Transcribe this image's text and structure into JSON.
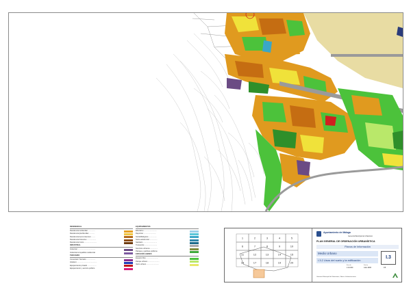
{
  "map": {
    "description_colors": {
      "residential_yellow": "#f0e23a",
      "residential_orange": "#e09a1f",
      "residential_darkorange": "#c56d12",
      "green_space": "#4cc23b",
      "dark_green": "#2f8f2a",
      "industrial_tan": "#e8dca3",
      "equipment_purple": "#6b4b84",
      "road_gray": "#9a9a9a",
      "water_blue": "#3aa7c8",
      "red": "#d0201f",
      "light_green": "#b9e86a"
    }
  },
  "legend": {
    "left_col": {
      "heading_a": "RESIDENCIAL",
      "items_a": [
        {
          "label": "Residencial unifamiliar ..............",
          "color": "#e6a125"
        },
        {
          "label": "Residencial plurifamiliar ...........",
          "color": "#f0c540"
        },
        {
          "label": "Residencial semi-intensivo ........",
          "color": "#b56a1a"
        },
        {
          "label": "Residencial intensivo ..................",
          "color": "#8c4c12"
        },
        {
          "label": "Residencial mixto .........................",
          "color": "#6e3a0e"
        }
      ],
      "heading_b": "INDUSTRIAL",
      "items_b": [
        {
          "label": "Industrial ....................................",
          "color": "#6b4b84"
        },
        {
          "label": "Industrial compatible residencial",
          "color": "#7c5aa0"
        }
      ],
      "heading_c": "TERCIARIO",
      "items_c": [
        {
          "label": "Comercial / Terciario ..................",
          "color": "#8a2b8e"
        },
        {
          "label": "Hotelero ........................................",
          "color": "#1e3ab5"
        },
        {
          "label": "Equipamiento privado ..................",
          "color": "#c01818"
        },
        {
          "label": "Equipamiento y servicio público",
          "color": "#d7197a"
        }
      ]
    },
    "right_col": {
      "heading_a": "EQUIPAMIENTOS",
      "items_a": [
        {
          "label": "Educativo ..........................",
          "color": "#9dd0e8"
        },
        {
          "label": "Deportivo .........................",
          "color": "#58c6d8"
        },
        {
          "label": "Social/Religioso ................",
          "color": "#3aa7c8"
        },
        {
          "label": "Socio-asistencial ................",
          "color": "#2f86a8"
        },
        {
          "label": "Sanitario ............................",
          "color": "#1b6a8a"
        },
        {
          "label": "Transporte .........................",
          "color": "#a9a9a9"
        },
        {
          "label": "Servicios urbanos ...............",
          "color": "#7f8b3a"
        },
        {
          "label": "Parques y jardines públicos",
          "color": "#3fa83a"
        }
      ],
      "heading_b": "ESPACIOS LIBRES",
      "items_b": [
        {
          "label": "Espacio libre ........................",
          "color": "#4cc23b"
        },
        {
          "label": "Parque urbano .......................",
          "color": "#b9e86a"
        },
        {
          "label": "Vacío urbano .........................",
          "color": "#e8e86a"
        }
      ]
    }
  },
  "title_block": {
    "municipality": "Ayuntamiento de Málaga",
    "department": "Gerencia Municipal de Urbanismo",
    "plan_title": "PLAN GENERAL DE ORDENACIÓN URBANÍSTICA",
    "series_label": "Planos de Información",
    "sheet_subject": "Medio Urbano",
    "sheet_title": "I.3.2 Usos del suelo y la edificación",
    "sheet_code": "I.3",
    "scale_label": "Escala",
    "scale_value": "1:10.000",
    "date_label": "Fecha",
    "date_value": "Julio 2006",
    "sheet_number": "15",
    "footer": "Gerencia Municipal de Urbanismo, Obras e Infraestructuras",
    "key_map_cells": [
      "1",
      "2",
      "3",
      "4",
      "5",
      "6",
      "7",
      "8",
      "9",
      "10",
      "11",
      "12",
      "13",
      "14",
      "15",
      "16",
      "17",
      "18",
      "19",
      "20"
    ]
  }
}
